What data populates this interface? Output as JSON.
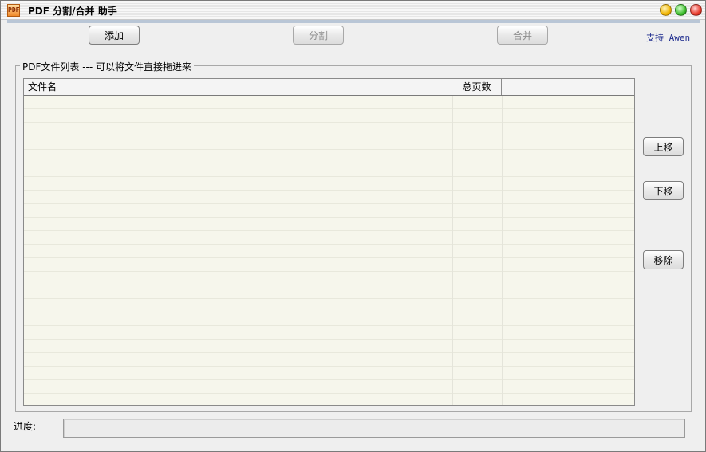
{
  "window": {
    "title": "PDF 分割/合并 助手",
    "app_icon": "PDF"
  },
  "toolbar": {
    "add_label": "添加",
    "split_label": "分割",
    "merge_label": "合并",
    "support_label": "支持 Awen"
  },
  "file_list": {
    "group_title": "PDF文件列表  --- 可以将文件直接拖进来",
    "columns": [
      "文件名",
      "总页数"
    ],
    "rows": []
  },
  "side_buttons": {
    "move_up_label": "上移",
    "move_down_label": "下移",
    "remove_label": "移除"
  },
  "progress": {
    "label": "进度:",
    "value": 0
  },
  "colors": {
    "list_background": "#f6f6ec",
    "link": "#1d2b8e"
  }
}
